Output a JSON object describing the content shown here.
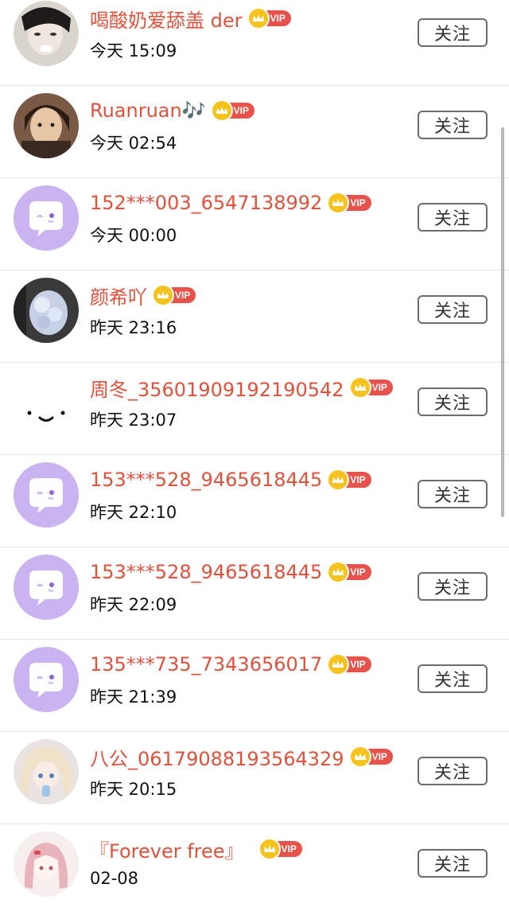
{
  "follow_label": "关注",
  "vip_label": "VIP",
  "rows": [
    {
      "name": "喝酸奶爱舔盖 der",
      "time": "今天 15:09",
      "avatar": "photo-avatar"
    },
    {
      "name": "Ruanruan🎶",
      "time": "今天 02:54",
      "avatar": "photo-avatar"
    },
    {
      "name": "152***003_6547138992",
      "time": "今天 00:00",
      "avatar": "default-chat-avatar"
    },
    {
      "name": "颜希吖",
      "time": "昨天 23:16",
      "avatar": "photo-avatar"
    },
    {
      "name": "周冬_35601909192190542",
      "time": "昨天 23:07",
      "avatar": "smiley-avatar"
    },
    {
      "name": "153***528_9465618445",
      "time": "昨天 22:10",
      "avatar": "default-chat-avatar"
    },
    {
      "name": "153***528_9465618445",
      "time": "昨天 22:09",
      "avatar": "default-chat-avatar"
    },
    {
      "name": "135***735_7343656017",
      "time": "昨天 21:39",
      "avatar": "default-chat-avatar"
    },
    {
      "name": "八公_06179088193564329",
      "time": "昨天 20:15",
      "avatar": "photo-avatar"
    },
    {
      "name": "『Forever free』",
      "time": "02-08",
      "avatar": "photo-avatar"
    }
  ],
  "colors": {
    "name": "#e2503a",
    "vip_badge": "#e9524a",
    "crown": "#f6c21c",
    "default_avatar": "#c9b3f0"
  }
}
